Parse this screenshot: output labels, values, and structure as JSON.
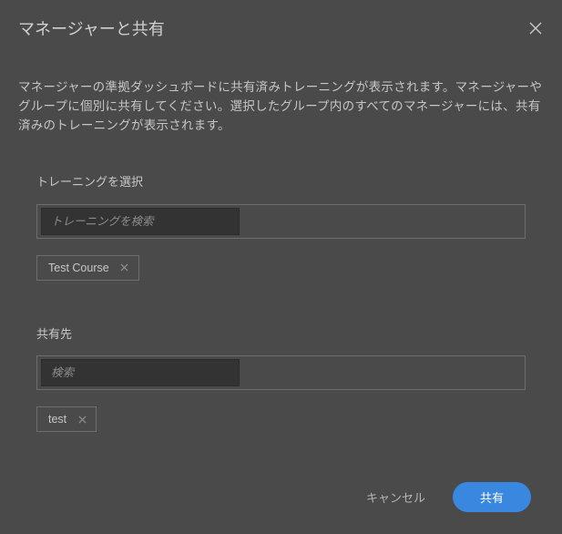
{
  "colors": {
    "background": "#4a4a4a",
    "input_bg": "#333333",
    "border": "#6d6d6d",
    "text": "#d0d0d0",
    "primary": "#3a87e0"
  },
  "header": {
    "title": "マネージャーと共有"
  },
  "description": "マネージャーの準拠ダッシュボードに共有済みトレーニングが表示されます。マネージャーやグループに個別に共有してください。選択したグループ内のすべてのマネージャーには、共有済みのトレーニングが表示されます。",
  "training": {
    "label": "トレーニングを選択",
    "placeholder": "トレーニングを検索",
    "selected": [
      {
        "name": "Test Course"
      }
    ]
  },
  "share_with": {
    "label": "共有先",
    "placeholder": "検索",
    "selected": [
      {
        "name": "test"
      }
    ]
  },
  "footer": {
    "cancel": "キャンセル",
    "submit": "共有"
  }
}
